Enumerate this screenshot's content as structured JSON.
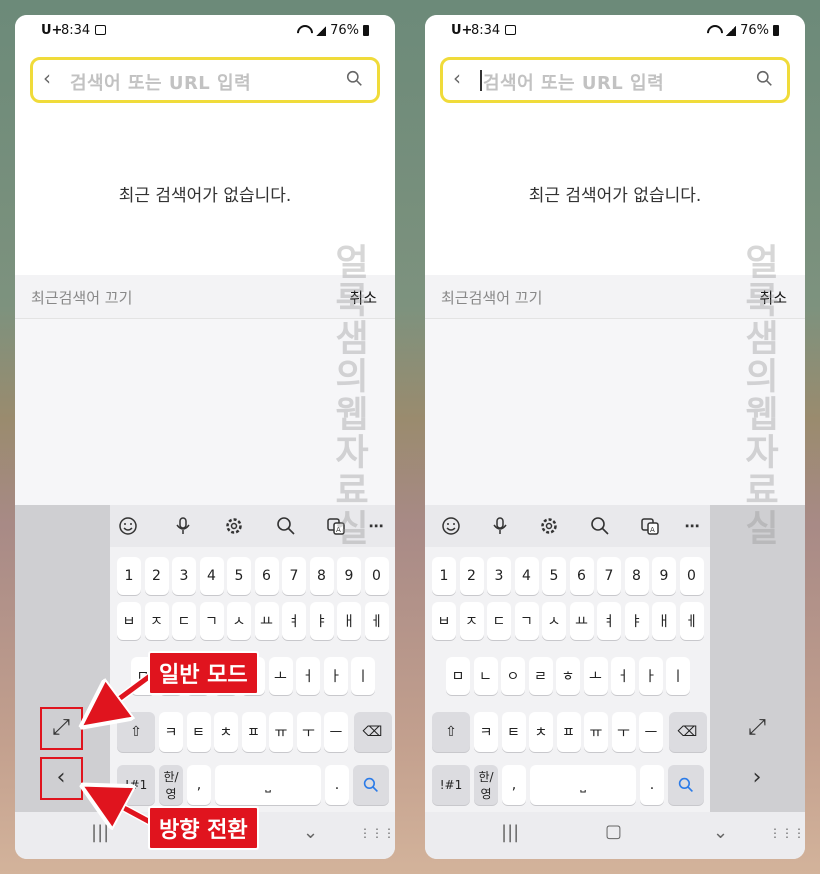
{
  "status": {
    "carrier": "U+",
    "time": "8:34",
    "battery": "76%"
  },
  "search": {
    "placeholder": "검색어 또는 URL 입력"
  },
  "empty_message": "최근 검색어가 없습니다.",
  "recent_off_label": "최근검색어 끄기",
  "cancel_label": "취소",
  "watermark": "얼룩샘의웹자료실",
  "keyboard": {
    "numbers": [
      "1",
      "2",
      "3",
      "4",
      "5",
      "6",
      "7",
      "8",
      "9",
      "0"
    ],
    "row1": [
      "ㅂ",
      "ㅈ",
      "ㄷ",
      "ㄱ",
      "ㅅ",
      "ㅛ",
      "ㅕ",
      "ㅑ",
      "ㅐ",
      "ㅔ"
    ],
    "row2": [
      "ㅁ",
      "ㄴ",
      "ㅇ",
      "ㄹ",
      "ㅎ",
      "ㅗ",
      "ㅓ",
      "ㅏ",
      "ㅣ"
    ],
    "row3": [
      "ㅋ",
      "ㅌ",
      "ㅊ",
      "ㅍ",
      "ㅠ",
      "ㅜ",
      "ㅡ"
    ],
    "sym_label": "!#1",
    "lang_label": "한/영",
    "comma": ",",
    "period": "."
  },
  "callouts": {
    "normal_mode": "일반 모드",
    "switch_direction": "방향 전환"
  },
  "colors": {
    "highlight": "#f0db3a",
    "callout": "#e0141e",
    "search_blue": "#2b7be8"
  }
}
